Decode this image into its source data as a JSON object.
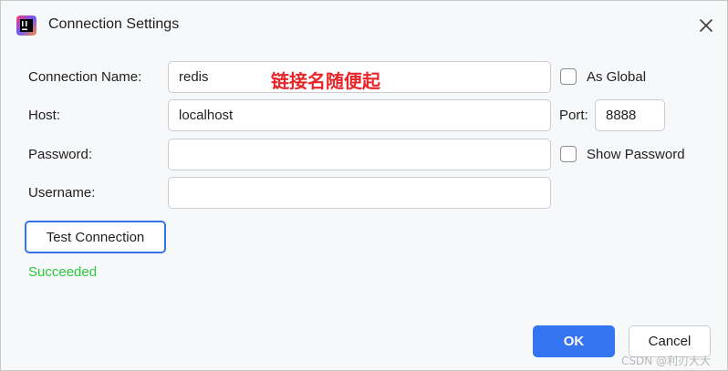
{
  "window": {
    "title": "Connection Settings",
    "app_icon": "intellij-idea-icon",
    "close_icon": "close-icon"
  },
  "form": {
    "connection_name": {
      "label": "Connection Name:",
      "value": "redis"
    },
    "as_global": {
      "label": "As Global",
      "checked": false
    },
    "host": {
      "label": "Host:",
      "value": "localhost"
    },
    "port": {
      "label": "Port:",
      "value": "8888"
    },
    "password": {
      "label": "Password:",
      "value": ""
    },
    "show_password": {
      "label": "Show Password",
      "checked": false
    },
    "username": {
      "label": "Username:",
      "value": ""
    }
  },
  "annotation": {
    "text": "链接名随便起",
    "color": "#e8262a"
  },
  "test": {
    "button_label": "Test Connection",
    "status": "Succeeded",
    "status_color": "#29cc3a"
  },
  "footer": {
    "ok_label": "OK",
    "cancel_label": "Cancel",
    "accent": "#3574f0"
  },
  "watermark": "CSDN @利刃大大"
}
